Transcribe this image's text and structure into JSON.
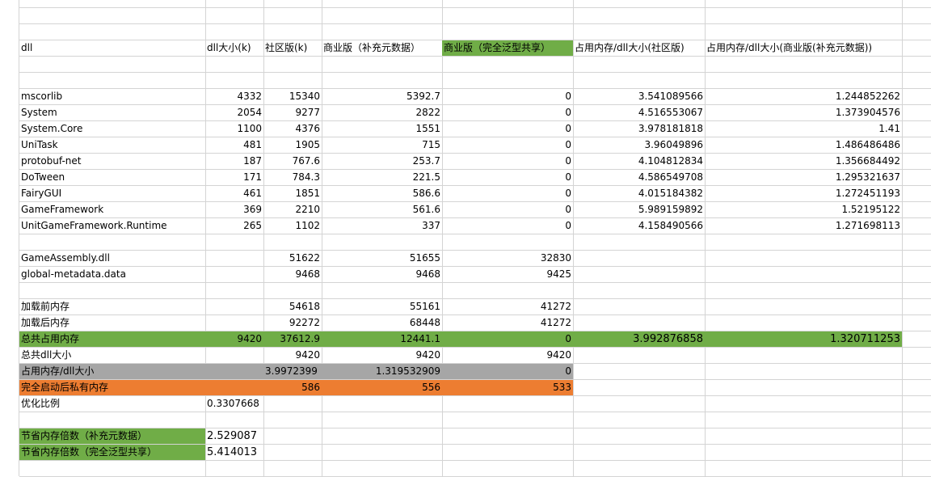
{
  "colors": {
    "green": "#70ad47",
    "gray": "#a6a6a6",
    "orange": "#ed7d31",
    "grid": "#d4d4d4"
  },
  "cells": [
    {
      "r": 2,
      "c": 0,
      "v": "dll"
    },
    {
      "r": 2,
      "c": 1,
      "v": "dll大小(k)"
    },
    {
      "r": 2,
      "c": 2,
      "v": "社区版(k)"
    },
    {
      "r": 2,
      "c": 3,
      "v": "商业版（补充元数据）"
    },
    {
      "r": 2,
      "c": 4,
      "v": "商业版（完全泛型共享）"
    },
    {
      "r": 2,
      "c": 5,
      "v": "占用内存/dll大小(社区版)"
    },
    {
      "r": 2,
      "c": 6,
      "v": "占用内存/dll大小(商业版(补充元数据))"
    },
    {
      "r": 5,
      "c": 0,
      "v": "mscorlib"
    },
    {
      "r": 5,
      "c": 1,
      "v": "4332",
      "n": 1
    },
    {
      "r": 5,
      "c": 2,
      "v": "15340",
      "n": 1
    },
    {
      "r": 5,
      "c": 3,
      "v": "5392.7",
      "n": 1
    },
    {
      "r": 5,
      "c": 4,
      "v": "0",
      "n": 1
    },
    {
      "r": 5,
      "c": 5,
      "v": "3.541089566",
      "n": 1
    },
    {
      "r": 5,
      "c": 6,
      "v": "1.244852262",
      "n": 1
    },
    {
      "r": 6,
      "c": 0,
      "v": "System"
    },
    {
      "r": 6,
      "c": 1,
      "v": "2054",
      "n": 1
    },
    {
      "r": 6,
      "c": 2,
      "v": "9277",
      "n": 1
    },
    {
      "r": 6,
      "c": 3,
      "v": "2822",
      "n": 1
    },
    {
      "r": 6,
      "c": 4,
      "v": "0",
      "n": 1
    },
    {
      "r": 6,
      "c": 5,
      "v": "4.516553067",
      "n": 1
    },
    {
      "r": 6,
      "c": 6,
      "v": "1.373904576",
      "n": 1
    },
    {
      "r": 7,
      "c": 0,
      "v": "System.Core"
    },
    {
      "r": 7,
      "c": 1,
      "v": "1100",
      "n": 1
    },
    {
      "r": 7,
      "c": 2,
      "v": "4376",
      "n": 1
    },
    {
      "r": 7,
      "c": 3,
      "v": "1551",
      "n": 1
    },
    {
      "r": 7,
      "c": 4,
      "v": "0",
      "n": 1
    },
    {
      "r": 7,
      "c": 5,
      "v": "3.978181818",
      "n": 1
    },
    {
      "r": 7,
      "c": 6,
      "v": "1.41",
      "n": 1
    },
    {
      "r": 8,
      "c": 0,
      "v": "UniTask"
    },
    {
      "r": 8,
      "c": 1,
      "v": "481",
      "n": 1
    },
    {
      "r": 8,
      "c": 2,
      "v": "1905",
      "n": 1
    },
    {
      "r": 8,
      "c": 3,
      "v": "715",
      "n": 1
    },
    {
      "r": 8,
      "c": 4,
      "v": "0",
      "n": 1
    },
    {
      "r": 8,
      "c": 5,
      "v": "3.96049896",
      "n": 1
    },
    {
      "r": 8,
      "c": 6,
      "v": "1.486486486",
      "n": 1
    },
    {
      "r": 9,
      "c": 0,
      "v": "protobuf-net"
    },
    {
      "r": 9,
      "c": 1,
      "v": "187",
      "n": 1
    },
    {
      "r": 9,
      "c": 2,
      "v": "767.6",
      "n": 1
    },
    {
      "r": 9,
      "c": 3,
      "v": "253.7",
      "n": 1
    },
    {
      "r": 9,
      "c": 4,
      "v": "0",
      "n": 1
    },
    {
      "r": 9,
      "c": 5,
      "v": "4.104812834",
      "n": 1
    },
    {
      "r": 9,
      "c": 6,
      "v": "1.356684492",
      "n": 1
    },
    {
      "r": 10,
      "c": 0,
      "v": "DoTween"
    },
    {
      "r": 10,
      "c": 1,
      "v": "171",
      "n": 1
    },
    {
      "r": 10,
      "c": 2,
      "v": "784.3",
      "n": 1
    },
    {
      "r": 10,
      "c": 3,
      "v": "221.5",
      "n": 1
    },
    {
      "r": 10,
      "c": 4,
      "v": "0",
      "n": 1
    },
    {
      "r": 10,
      "c": 5,
      "v": "4.586549708",
      "n": 1
    },
    {
      "r": 10,
      "c": 6,
      "v": "1.295321637",
      "n": 1
    },
    {
      "r": 11,
      "c": 0,
      "v": "FairyGUI"
    },
    {
      "r": 11,
      "c": 1,
      "v": "461",
      "n": 1
    },
    {
      "r": 11,
      "c": 2,
      "v": "1851",
      "n": 1
    },
    {
      "r": 11,
      "c": 3,
      "v": "586.6",
      "n": 1
    },
    {
      "r": 11,
      "c": 4,
      "v": "0",
      "n": 1
    },
    {
      "r": 11,
      "c": 5,
      "v": "4.015184382",
      "n": 1
    },
    {
      "r": 11,
      "c": 6,
      "v": "1.272451193",
      "n": 1
    },
    {
      "r": 12,
      "c": 0,
      "v": "GameFramework"
    },
    {
      "r": 12,
      "c": 1,
      "v": "369",
      "n": 1
    },
    {
      "r": 12,
      "c": 2,
      "v": "2210",
      "n": 1
    },
    {
      "r": 12,
      "c": 3,
      "v": "561.6",
      "n": 1
    },
    {
      "r": 12,
      "c": 4,
      "v": "0",
      "n": 1
    },
    {
      "r": 12,
      "c": 5,
      "v": "5.989159892",
      "n": 1
    },
    {
      "r": 12,
      "c": 6,
      "v": "1.52195122",
      "n": 1
    },
    {
      "r": 13,
      "c": 0,
      "v": "UnitGameFramework.Runtime"
    },
    {
      "r": 13,
      "c": 1,
      "v": "265",
      "n": 1
    },
    {
      "r": 13,
      "c": 2,
      "v": "1102",
      "n": 1
    },
    {
      "r": 13,
      "c": 3,
      "v": "337",
      "n": 1
    },
    {
      "r": 13,
      "c": 4,
      "v": "0",
      "n": 1
    },
    {
      "r": 13,
      "c": 5,
      "v": "4.158490566",
      "n": 1
    },
    {
      "r": 13,
      "c": 6,
      "v": "1.271698113",
      "n": 1
    },
    {
      "r": 15,
      "c": 0,
      "v": "GameAssembly.dll"
    },
    {
      "r": 15,
      "c": 2,
      "v": "51622",
      "n": 1
    },
    {
      "r": 15,
      "c": 3,
      "v": "51655",
      "n": 1
    },
    {
      "r": 15,
      "c": 4,
      "v": "32830",
      "n": 1
    },
    {
      "r": 16,
      "c": 0,
      "v": "global-metadata.data"
    },
    {
      "r": 16,
      "c": 2,
      "v": "9468",
      "n": 1
    },
    {
      "r": 16,
      "c": 3,
      "v": "9468",
      "n": 1
    },
    {
      "r": 16,
      "c": 4,
      "v": "9425",
      "n": 1
    },
    {
      "r": 18,
      "c": 0,
      "v": "加载前内存"
    },
    {
      "r": 18,
      "c": 2,
      "v": "54618",
      "n": 1
    },
    {
      "r": 18,
      "c": 3,
      "v": "55161",
      "n": 1
    },
    {
      "r": 18,
      "c": 4,
      "v": "41272",
      "n": 1
    },
    {
      "r": 19,
      "c": 0,
      "v": "加载后内存"
    },
    {
      "r": 19,
      "c": 2,
      "v": "92272",
      "n": 1
    },
    {
      "r": 19,
      "c": 3,
      "v": "68448",
      "n": 1
    },
    {
      "r": 19,
      "c": 4,
      "v": "41272",
      "n": 1
    },
    {
      "r": 20,
      "c": 0,
      "v": "总共占用内存"
    },
    {
      "r": 20,
      "c": 1,
      "v": "9420",
      "n": 1
    },
    {
      "r": 20,
      "c": 2,
      "v": "37612.9",
      "n": 1
    },
    {
      "r": 20,
      "c": 3,
      "v": "12441.1",
      "n": 1
    },
    {
      "r": 20,
      "c": 4,
      "v": "0",
      "n": 1
    },
    {
      "r": 20,
      "c": 5,
      "v": "3.992876858",
      "n": 1,
      "big": 1
    },
    {
      "r": 20,
      "c": 6,
      "v": "1.320711253",
      "n": 1,
      "big": 1
    },
    {
      "r": 21,
      "c": 0,
      "v": "总共dll大小"
    },
    {
      "r": 21,
      "c": 2,
      "v": "9420",
      "n": 1
    },
    {
      "r": 21,
      "c": 3,
      "v": "9420",
      "n": 1
    },
    {
      "r": 21,
      "c": 4,
      "v": "9420",
      "n": 1
    },
    {
      "r": 22,
      "c": 0,
      "v": "占用内存/dll大小"
    },
    {
      "r": 22,
      "c": 2,
      "v": "3.9972399"
    },
    {
      "r": 22,
      "c": 3,
      "v": "1.319532909",
      "n": 1
    },
    {
      "r": 22,
      "c": 4,
      "v": "0",
      "n": 1
    },
    {
      "r": 23,
      "c": 0,
      "v": "完全启动后私有内存"
    },
    {
      "r": 23,
      "c": 2,
      "v": "586",
      "n": 1
    },
    {
      "r": 23,
      "c": 3,
      "v": "556",
      "n": 1
    },
    {
      "r": 23,
      "c": 4,
      "v": "533",
      "n": 1
    },
    {
      "r": 24,
      "c": 0,
      "v": "优化比例"
    },
    {
      "r": 24,
      "c": 1,
      "v": "0.3307668"
    },
    {
      "r": 26,
      "c": 0,
      "v": "节省内存倍数（补充元数据）"
    },
    {
      "r": 26,
      "c": 1,
      "v": "2.529087",
      "big": 1
    },
    {
      "r": 27,
      "c": 0,
      "v": "节省内存倍数（完全泛型共享）"
    },
    {
      "r": 27,
      "c": 1,
      "v": "5.414013",
      "big": 1
    }
  ],
  "fills": [
    {
      "r": 2,
      "c0": 4,
      "c1": 4,
      "color": "#70ad47"
    },
    {
      "r": 20,
      "c0": 0,
      "c1": 6,
      "color": "#70ad47"
    },
    {
      "r": 22,
      "c0": 0,
      "c1": 4,
      "color": "#a6a6a6"
    },
    {
      "r": 23,
      "c0": 0,
      "c1": 4,
      "color": "#ed7d31"
    },
    {
      "r": 26,
      "c0": 0,
      "c1": 0,
      "color": "#70ad47"
    },
    {
      "r": 27,
      "c0": 0,
      "c1": 0,
      "color": "#70ad47"
    }
  ]
}
